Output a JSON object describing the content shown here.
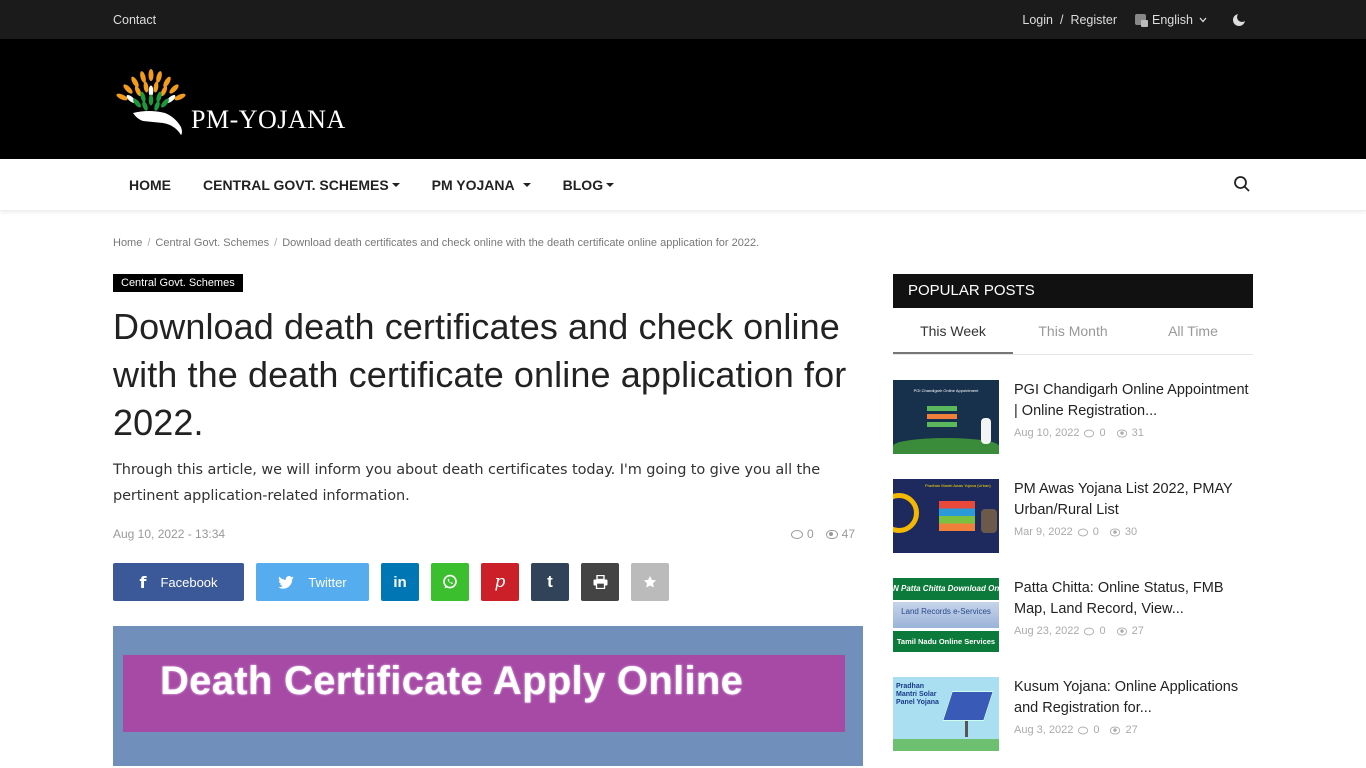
{
  "topbar": {
    "contact": "Contact",
    "login": "Login",
    "separator": "/",
    "register": "Register",
    "language": "English"
  },
  "header": {
    "logo_text": "PM-YOJANA"
  },
  "nav": {
    "items": [
      {
        "label": "HOME",
        "dropdown": false
      },
      {
        "label": "CENTRAL GOVT. SCHEMES",
        "dropdown": true
      },
      {
        "label": "PM YOJANA",
        "dropdown": true
      },
      {
        "label": "BLOG",
        "dropdown": true
      }
    ]
  },
  "breadcrumb": {
    "items": [
      "Home",
      "Central Govt. Schemes",
      "Download death certificates and check online with the death certificate online application for 2022."
    ],
    "separator": "/"
  },
  "article": {
    "category": "Central Govt. Schemes",
    "title": "Download death certificates and check online with the death certificate online application for 2022.",
    "excerpt": "Through this article, we will inform you about death certificates today. I'm going to give you all the pertinent application-related information.",
    "date": "Aug 10, 2022 - 13:34",
    "comments": "0",
    "views": "47",
    "share": {
      "facebook": "Facebook",
      "twitter": "Twitter"
    },
    "hero_text": "Death Certificate Apply Online"
  },
  "sidebar": {
    "heading": "POPULAR POSTS",
    "tabs": [
      "This Week",
      "This Month",
      "All Time"
    ],
    "active_tab": "This Week",
    "posts": [
      {
        "title": "PGI Chandigarh Online Appointment | Online Registration...",
        "date": "Aug 10, 2022",
        "comments": "0",
        "views": "31"
      },
      {
        "title": "PM Awas Yojana List 2022, PMAY Urban/Rural List",
        "date": "Mar 9, 2022",
        "comments": "0",
        "views": "30"
      },
      {
        "title": "Patta Chitta: Online Status, FMB Map, Land Record, View...",
        "date": "Aug 23, 2022",
        "comments": "0",
        "views": "27"
      },
      {
        "title": "Kusum Yojana: Online Applications and Registration for...",
        "date": "Aug 3, 2022",
        "comments": "0",
        "views": "27"
      }
    ],
    "thumb_text": {
      "t1": "PGI Chandigarh Online Appointment",
      "t2": "Pradhan Mantri Awas Yojana (Urban)",
      "t3a": "N Patta Chitta Download Online",
      "t3b": "Land Records e-Services",
      "t3c": "Tamil Nadu Online Services",
      "t4": "Pradhan Mantri Solar Panel Yojana"
    }
  }
}
